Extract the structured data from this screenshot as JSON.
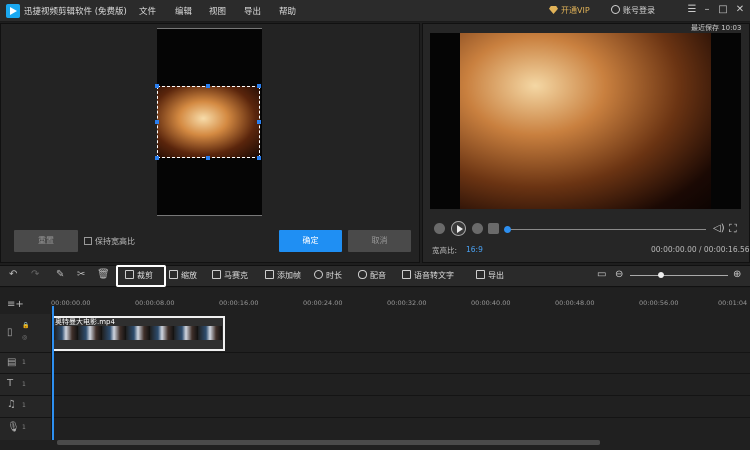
{
  "app": {
    "title": "迅捷视频剪辑软件 (免费版)"
  },
  "menu": [
    "文件",
    "编辑",
    "视图",
    "导出",
    "帮助"
  ],
  "header": {
    "vip": "开通VIP",
    "login": "账号登录",
    "window_buttons": [
      "☰",
      "–",
      "□",
      "✕"
    ]
  },
  "crop": {
    "reset": "重置",
    "keep_ratio": "保持宽高比",
    "keep_ratio_checked": false,
    "confirm": "确定",
    "cancel": "取消"
  },
  "preview": {
    "last_saved": "最近保存 10:03",
    "aspect_label": "宽高比:",
    "aspect_value": "16:9",
    "time": "00:00:00.00 / 00:00:16.56",
    "progress": 0
  },
  "toolbar": {
    "crop": "裁剪",
    "zoom": "缩放",
    "mosaic": "马赛克",
    "freeze": "添加帧",
    "duration": "时长",
    "dub": "配音",
    "speech_to_text": "语音转文字",
    "export": "导出"
  },
  "timeline": {
    "ticks": [
      "00:00:00.00",
      "00:00:08.00",
      "00:00:16.00",
      "00:00:24.00",
      "00:00:32.00",
      "00:00:40.00",
      "00:00:48.00",
      "00:00:56.00",
      "00:01:04"
    ],
    "clip_name": "奥特曼大电影.mp4",
    "track_num": "1"
  }
}
